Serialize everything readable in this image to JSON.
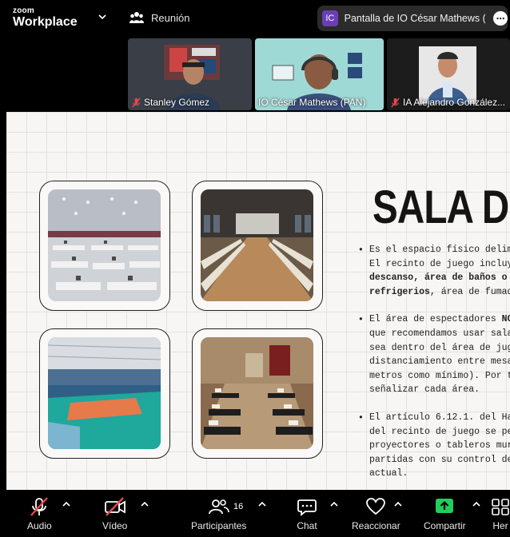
{
  "app": {
    "brand_small": "zoom",
    "brand_large": "Workplace"
  },
  "meeting": {
    "label": "Reunión"
  },
  "share": {
    "avatar": "IC",
    "label": "Pantalla de IO César Mathews (PA"
  },
  "participants_strip": [
    {
      "name": "Stanley Gómez",
      "muted": true,
      "active": false
    },
    {
      "name": "IO César Mathews (PAN)",
      "muted": false,
      "active": true
    },
    {
      "name": "IA Alejandro González...",
      "muted": true,
      "active": false
    }
  ],
  "slide": {
    "title": "SALA DE",
    "bullets": [
      {
        "lines": [
          "Es el espacio físico delim",
          "El recinto de juego incluy"
        ],
        "bold_line": {
          "bold": "descanso, área de baños o",
          "rest": ""
        },
        "mixed_line": {
          "bold": "refrigerios",
          "rest": ", área de fumad"
        }
      },
      {
        "first": {
          "text": "El área de espectadores ",
          "bold": "NO"
        },
        "lines": [
          "que recomendamos usar sala",
          "sea dentro del área de jug",
          "distanciamiento entre mesa",
          "metros como mínimo). Por t",
          "señalizar cada área."
        ]
      },
      {
        "lines": [
          "El artículo 6.12.1. del Ha",
          "del recinto de juego se pe",
          "proyectores o tableros mur",
          "partidas con su control de",
          "actual."
        ]
      }
    ]
  },
  "toolbar": {
    "audio": "Audio",
    "video": "Vídeo",
    "participants": "Participantes",
    "participants_count": "16",
    "chat": "Chat",
    "reactions": "Reaccionar",
    "share": "Compartir",
    "more": "Her"
  },
  "colors": {
    "active_border": "#23d18b",
    "share_green": "#1fcf5a",
    "muted_red": "#e5484d",
    "share_avatar": "#6a3fb5"
  }
}
